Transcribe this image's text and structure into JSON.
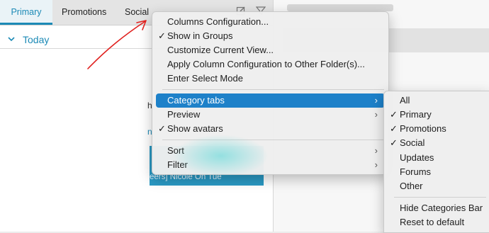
{
  "tabs": {
    "primary": "Primary",
    "promotions": "Promotions",
    "social": "Social"
  },
  "list": {
    "group_label": "Today",
    "fragment_a": "h",
    "fragment_b": "n",
    "selected_fragment": "eers] Nicole On Tue"
  },
  "context_menu": {
    "items": [
      {
        "label": "Columns Configuration...",
        "checked": ""
      },
      {
        "label": "Show in Groups",
        "checked": "✓"
      },
      {
        "label": "Customize Current View...",
        "checked": ""
      },
      {
        "label": "Apply Column Configuration to Other Folder(s)...",
        "checked": ""
      },
      {
        "label": "Enter Select Mode",
        "checked": ""
      },
      {
        "label": "Category tabs",
        "checked": "",
        "submenu_arrow": "›"
      },
      {
        "label": "Preview",
        "checked": "",
        "submenu_arrow": "›"
      },
      {
        "label": "Show avatars",
        "checked": "✓"
      },
      {
        "label": "Sort",
        "checked": "",
        "submenu_arrow": "›"
      },
      {
        "label": "Filter",
        "checked": "",
        "submenu_arrow": "›"
      }
    ]
  },
  "category_submenu": {
    "items": [
      {
        "label": "All",
        "checked": ""
      },
      {
        "label": "Primary",
        "checked": "✓"
      },
      {
        "label": "Promotions",
        "checked": "✓"
      },
      {
        "label": "Social",
        "checked": "✓"
      },
      {
        "label": "Updates",
        "checked": ""
      },
      {
        "label": "Forums",
        "checked": ""
      },
      {
        "label": "Other",
        "checked": ""
      },
      {
        "label": "Hide Categories Bar",
        "checked": ""
      },
      {
        "label": "Reset to default",
        "checked": ""
      }
    ]
  },
  "colors": {
    "accent": "#1c8ab6",
    "highlight": "#1e81c9",
    "annotation": "#e0201e"
  },
  "icons": {
    "toolbar_1": "edit-icon",
    "toolbar_2": "filter-icon",
    "group_toggle": "chevron-down-icon",
    "submenu": "chevron-right-icon"
  }
}
